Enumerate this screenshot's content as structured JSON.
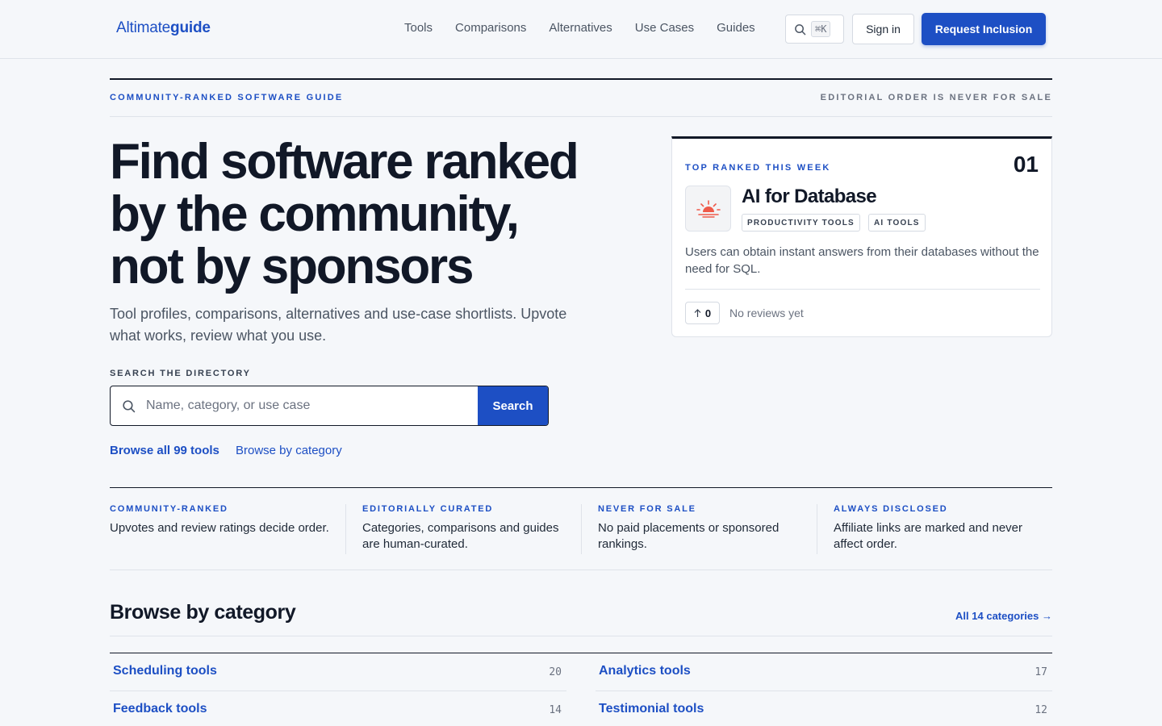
{
  "header": {
    "logo_prefix": "Altimate",
    "logo_suffix": "guide",
    "nav": [
      "Tools",
      "Comparisons",
      "Alternatives",
      "Use Cases",
      "Guides"
    ],
    "shortcut": "⌘K",
    "signin": "Sign in",
    "cta": "Request Inclusion"
  },
  "eyebrow": {
    "left": "COMMUNITY-RANKED SOFTWARE GUIDE",
    "right": "EDITORIAL ORDER IS NEVER FOR SALE"
  },
  "hero": {
    "title_line1": "Find software ranked",
    "title_line2": "by the community,",
    "title_line3": "not by sponsors",
    "subtitle": "Tool profiles, comparisons, alternatives and use-case shortlists. Upvote what works, review what you use.",
    "search_label": "SEARCH THE DIRECTORY",
    "search_placeholder": "Name, category, or use case",
    "search_button": "Search",
    "browse_all": "Browse all 99 tools",
    "browse_category": "Browse by category"
  },
  "featured": {
    "eyebrow": "TOP RANKED THIS WEEK",
    "rank": "01",
    "name": "AI for Database",
    "tags": [
      "PRODUCTIVITY TOOLS",
      "AI TOOLS"
    ],
    "description": "Users can obtain instant answers from their databases without the need for SQL.",
    "votes": "0",
    "reviews": "No reviews yet",
    "logo_icon": "sunset-icon"
  },
  "pillars": [
    {
      "heading": "COMMUNITY-RANKED",
      "text": "Upvotes and review ratings decide order."
    },
    {
      "heading": "EDITORIALLY CURATED",
      "text": "Categories, comparisons and guides are human-curated."
    },
    {
      "heading": "NEVER FOR SALE",
      "text": "No paid placements or sponsored rankings."
    },
    {
      "heading": "ALWAYS DISCLOSED",
      "text": "Affiliate links are marked and never affect order."
    }
  ],
  "categories": {
    "title": "Browse by category",
    "all_link": "All 14 categories →",
    "items": [
      {
        "name": "Scheduling tools",
        "count": "20"
      },
      {
        "name": "Analytics tools",
        "count": "17"
      },
      {
        "name": "Feedback tools",
        "count": "14"
      },
      {
        "name": "Testimonial tools",
        "count": "12"
      }
    ]
  },
  "colors": {
    "accent": "#1d4fc4",
    "ink": "#111827",
    "background": "#f5f7fa"
  }
}
